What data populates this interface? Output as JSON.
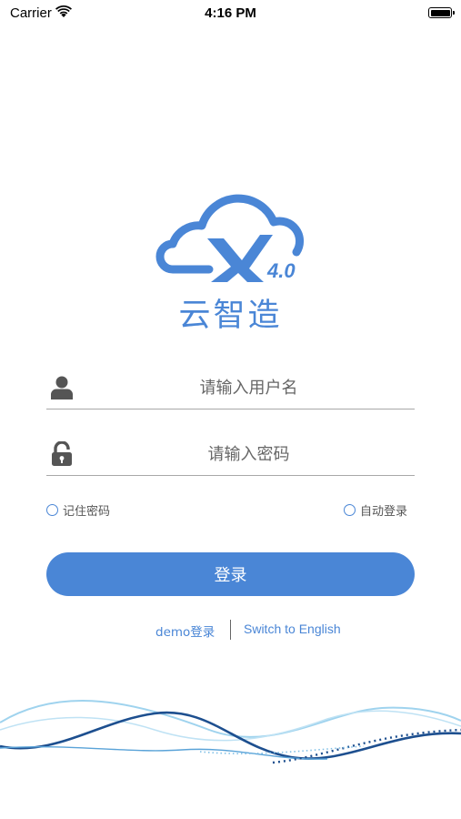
{
  "status_bar": {
    "carrier": "Carrier",
    "time": "4:16 PM",
    "wifi_icon": "wifi-icon",
    "battery_icon": "battery-icon",
    "battery_level": 1.0
  },
  "brand": {
    "logo_text": "4.0",
    "title": "云智造",
    "accent_color": "#4a86d6"
  },
  "login_form": {
    "username": {
      "placeholder": "请输入用户名",
      "value": "",
      "icon": "user-icon"
    },
    "password": {
      "placeholder": "请输入密码",
      "value": "",
      "icon": "lock-icon"
    },
    "remember_password": {
      "label": "记住密码",
      "checked": false
    },
    "auto_login": {
      "label": "自动登录",
      "checked": false
    },
    "login_button": "登录"
  },
  "links": {
    "demo_login": "demo登录",
    "switch_language": "Switch to English"
  }
}
